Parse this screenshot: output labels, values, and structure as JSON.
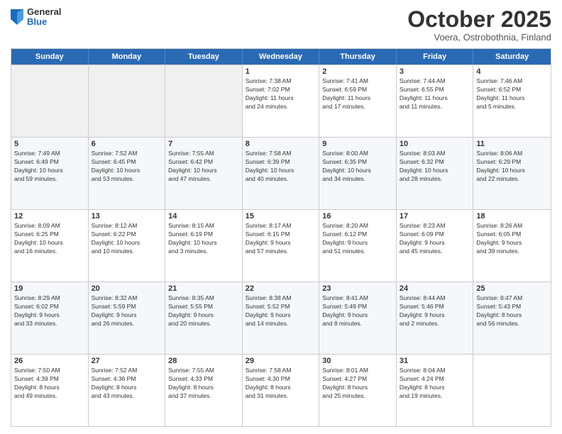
{
  "logo": {
    "general": "General",
    "blue": "Blue"
  },
  "header": {
    "month": "October 2025",
    "location": "Voera, Ostrobothnia, Finland"
  },
  "weekdays": [
    "Sunday",
    "Monday",
    "Tuesday",
    "Wednesday",
    "Thursday",
    "Friday",
    "Saturday"
  ],
  "rows": [
    [
      {
        "day": "",
        "info": ""
      },
      {
        "day": "",
        "info": ""
      },
      {
        "day": "",
        "info": ""
      },
      {
        "day": "1",
        "info": "Sunrise: 7:38 AM\nSunset: 7:02 PM\nDaylight: 11 hours\nand 24 minutes."
      },
      {
        "day": "2",
        "info": "Sunrise: 7:41 AM\nSunset: 6:59 PM\nDaylight: 11 hours\nand 17 minutes."
      },
      {
        "day": "3",
        "info": "Sunrise: 7:44 AM\nSunset: 6:55 PM\nDaylight: 11 hours\nand 11 minutes."
      },
      {
        "day": "4",
        "info": "Sunrise: 7:46 AM\nSunset: 6:52 PM\nDaylight: 11 hours\nand 5 minutes."
      }
    ],
    [
      {
        "day": "5",
        "info": "Sunrise: 7:49 AM\nSunset: 6:49 PM\nDaylight: 10 hours\nand 59 minutes."
      },
      {
        "day": "6",
        "info": "Sunrise: 7:52 AM\nSunset: 6:45 PM\nDaylight: 10 hours\nand 53 minutes."
      },
      {
        "day": "7",
        "info": "Sunrise: 7:55 AM\nSunset: 6:42 PM\nDaylight: 10 hours\nand 47 minutes."
      },
      {
        "day": "8",
        "info": "Sunrise: 7:58 AM\nSunset: 6:39 PM\nDaylight: 10 hours\nand 40 minutes."
      },
      {
        "day": "9",
        "info": "Sunrise: 8:00 AM\nSunset: 6:35 PM\nDaylight: 10 hours\nand 34 minutes."
      },
      {
        "day": "10",
        "info": "Sunrise: 8:03 AM\nSunset: 6:32 PM\nDaylight: 10 hours\nand 28 minutes."
      },
      {
        "day": "11",
        "info": "Sunrise: 8:06 AM\nSunset: 6:29 PM\nDaylight: 10 hours\nand 22 minutes."
      }
    ],
    [
      {
        "day": "12",
        "info": "Sunrise: 8:09 AM\nSunset: 6:25 PM\nDaylight: 10 hours\nand 16 minutes."
      },
      {
        "day": "13",
        "info": "Sunrise: 8:12 AM\nSunset: 6:22 PM\nDaylight: 10 hours\nand 10 minutes."
      },
      {
        "day": "14",
        "info": "Sunrise: 8:15 AM\nSunset: 6:19 PM\nDaylight: 10 hours\nand 3 minutes."
      },
      {
        "day": "15",
        "info": "Sunrise: 8:17 AM\nSunset: 6:15 PM\nDaylight: 9 hours\nand 57 minutes."
      },
      {
        "day": "16",
        "info": "Sunrise: 8:20 AM\nSunset: 6:12 PM\nDaylight: 9 hours\nand 51 minutes."
      },
      {
        "day": "17",
        "info": "Sunrise: 8:23 AM\nSunset: 6:09 PM\nDaylight: 9 hours\nand 45 minutes."
      },
      {
        "day": "18",
        "info": "Sunrise: 8:26 AM\nSunset: 6:05 PM\nDaylight: 9 hours\nand 39 minutes."
      }
    ],
    [
      {
        "day": "19",
        "info": "Sunrise: 8:29 AM\nSunset: 6:02 PM\nDaylight: 9 hours\nand 33 minutes."
      },
      {
        "day": "20",
        "info": "Sunrise: 8:32 AM\nSunset: 5:59 PM\nDaylight: 9 hours\nand 26 minutes."
      },
      {
        "day": "21",
        "info": "Sunrise: 8:35 AM\nSunset: 5:55 PM\nDaylight: 9 hours\nand 20 minutes."
      },
      {
        "day": "22",
        "info": "Sunrise: 8:38 AM\nSunset: 5:52 PM\nDaylight: 9 hours\nand 14 minutes."
      },
      {
        "day": "23",
        "info": "Sunrise: 8:41 AM\nSunset: 5:49 PM\nDaylight: 9 hours\nand 8 minutes."
      },
      {
        "day": "24",
        "info": "Sunrise: 8:44 AM\nSunset: 5:46 PM\nDaylight: 9 hours\nand 2 minutes."
      },
      {
        "day": "25",
        "info": "Sunrise: 8:47 AM\nSunset: 5:43 PM\nDaylight: 8 hours\nand 56 minutes."
      }
    ],
    [
      {
        "day": "26",
        "info": "Sunrise: 7:50 AM\nSunset: 4:39 PM\nDaylight: 8 hours\nand 49 minutes."
      },
      {
        "day": "27",
        "info": "Sunrise: 7:52 AM\nSunset: 4:36 PM\nDaylight: 8 hours\nand 43 minutes."
      },
      {
        "day": "28",
        "info": "Sunrise: 7:55 AM\nSunset: 4:33 PM\nDaylight: 8 hours\nand 37 minutes."
      },
      {
        "day": "29",
        "info": "Sunrise: 7:58 AM\nSunset: 4:30 PM\nDaylight: 8 hours\nand 31 minutes."
      },
      {
        "day": "30",
        "info": "Sunrise: 8:01 AM\nSunset: 4:27 PM\nDaylight: 8 hours\nand 25 minutes."
      },
      {
        "day": "31",
        "info": "Sunrise: 8:04 AM\nSunset: 4:24 PM\nDaylight: 8 hours\nand 19 minutes."
      },
      {
        "day": "",
        "info": ""
      }
    ]
  ]
}
